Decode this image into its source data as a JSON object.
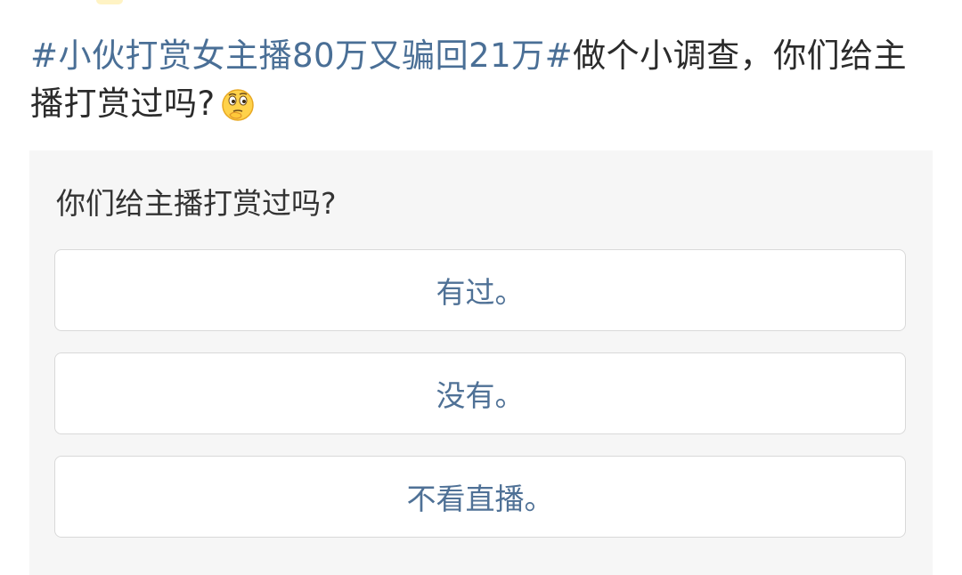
{
  "post": {
    "topic": "#小伙打赏女主播80万又骗回21万#",
    "text": "做个小调查，你们给主播打赏过吗?",
    "emoji": "thinking-face-icon"
  },
  "poll": {
    "question": "你们给主播打赏过吗?",
    "options": [
      {
        "label": "有过。"
      },
      {
        "label": "没有。"
      },
      {
        "label": "不看直播。"
      }
    ]
  },
  "colors": {
    "topic_link": "#4a6f96",
    "option_text": "#4f7196",
    "card_background": "#f6f6f6",
    "body_text": "#2b2b2b"
  }
}
